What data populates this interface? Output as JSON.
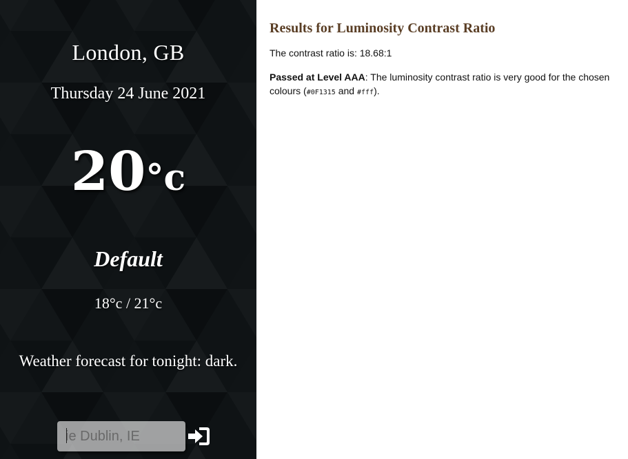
{
  "weather": {
    "city": "London, GB",
    "date": "Thursday 24 June 2021",
    "temperature_value": "20",
    "temperature_unit": "°c",
    "description": "Default",
    "low_high": "18°c / 21°c",
    "forecast": "Weather forecast for tonight: dark.",
    "search": {
      "placeholder": "ie Dublin, IE",
      "value": ""
    },
    "submit_icon": "sign-in-arrow-icon",
    "background_color": "#0f1315"
  },
  "results": {
    "title": "Results for Luminosity Contrast Ratio",
    "ratio_text": "The contrast ratio is: 18.68:1",
    "level_label": "Passed at Level AAA",
    "level_text": ": The luminosity contrast ratio is very good for the chosen colours (",
    "colour_one": "#0F1315",
    "and_text": " and ",
    "colour_two": "#fff",
    "closing_text": ").",
    "title_color": "#5a3e25"
  }
}
